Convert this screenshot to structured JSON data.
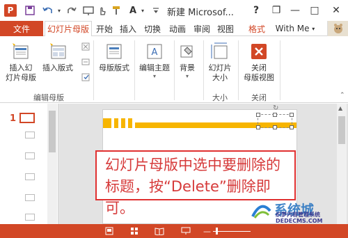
{
  "app": {
    "icon_letter": "P",
    "title": "新建 Microsof..."
  },
  "quick_access": {
    "icons": [
      "save-icon",
      "undo-icon",
      "redo-icon",
      "slideshow-icon",
      "touch-mode-icon",
      "format-painter-icon",
      "font-color-icon",
      "more-icon"
    ],
    "font_letter": "A"
  },
  "window": {
    "help": "?",
    "restore": "❐",
    "minimize": "—",
    "maximize": "□",
    "close": "✕"
  },
  "tabs": [
    {
      "label": "文件"
    },
    {
      "label": "幻灯片母版"
    },
    {
      "label": "开始"
    },
    {
      "label": "插入"
    },
    {
      "label": "切换"
    },
    {
      "label": "动画"
    },
    {
      "label": "审阅"
    },
    {
      "label": "视图"
    },
    {
      "label": "格式"
    }
  ],
  "account": {
    "name": "With Me"
  },
  "ribbon": {
    "insert_slide_master": [
      "插入幻",
      "灯片母版"
    ],
    "insert_layout": "插入版式",
    "master_layout": "母版版式",
    "edit_theme": "编辑主题",
    "background": "背景",
    "slide_size": [
      "幻灯片",
      "大小"
    ],
    "close_master_view": [
      "关闭",
      "母版视图"
    ],
    "groups": {
      "edit_master": "编辑母版",
      "size": "大小",
      "close": "关闭"
    }
  },
  "thumbnail": {
    "number": "1"
  },
  "callout": {
    "text": "幻灯片母版中选中要删除的标题，按“Delete”删除即可。"
  },
  "watermark": {
    "line1": "系统城",
    "line2": "DEDECMS.COM",
    "line3": "织梦内容管理系统"
  },
  "colors": {
    "accent": "#d24726",
    "callout_border": "#e03030",
    "slide_stripe": "#f7b500"
  }
}
